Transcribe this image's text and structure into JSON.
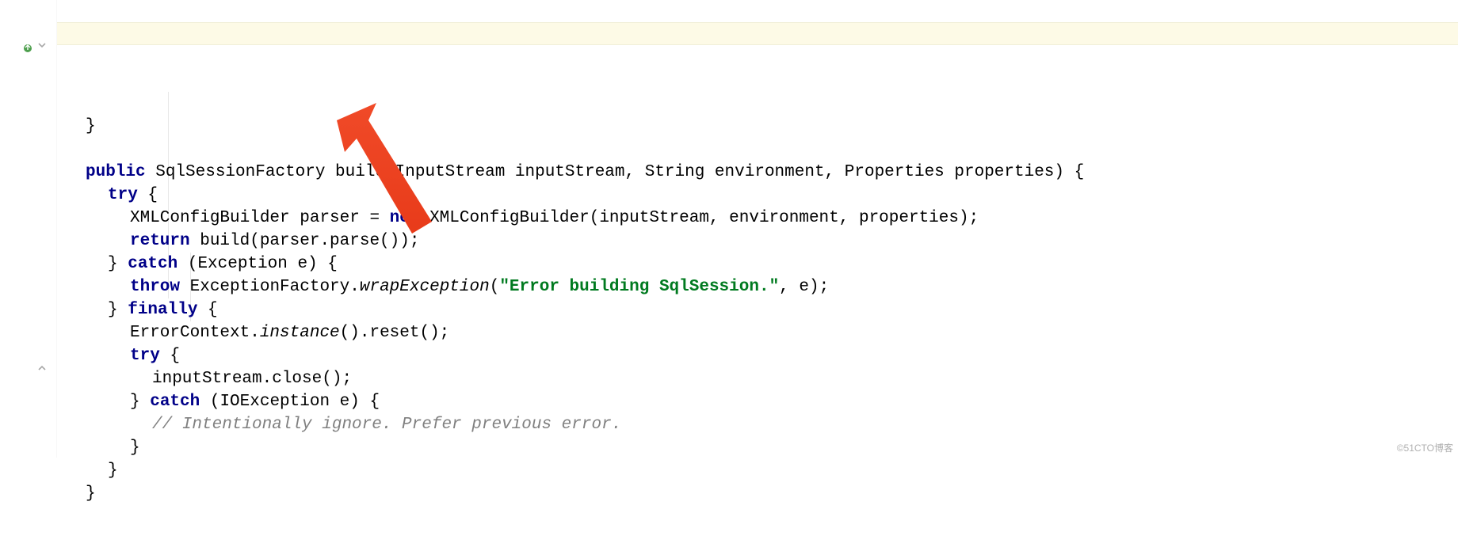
{
  "highlight_line_index": 1,
  "watermark": "©51CTO博客",
  "arrow_color": "#f04a28",
  "code": {
    "lines": [
      {
        "indent": 1,
        "tokens": [
          {
            "t": "}",
            "c": ""
          }
        ]
      },
      {
        "indent": 1,
        "tokens": []
      },
      {
        "indent": 1,
        "tokens": [
          {
            "t": "public ",
            "c": "kw"
          },
          {
            "t": "SqlSessionFactory build(InputStream inputStream, String environment, Properties properties) {",
            "c": ""
          }
        ]
      },
      {
        "indent": 2,
        "tokens": [
          {
            "t": "try ",
            "c": "kw"
          },
          {
            "t": "{",
            "c": ""
          }
        ]
      },
      {
        "indent": 3,
        "tokens": [
          {
            "t": "XMLConfigBuilder parser = ",
            "c": ""
          },
          {
            "t": "new ",
            "c": "kw"
          },
          {
            "t": "XMLConfigBuilder(inputStream, environment, properties);",
            "c": ""
          }
        ]
      },
      {
        "indent": 3,
        "tokens": [
          {
            "t": "return ",
            "c": "kw"
          },
          {
            "t": "build(parser.parse());",
            "c": ""
          }
        ]
      },
      {
        "indent": 2,
        "tokens": [
          {
            "t": "} ",
            "c": ""
          },
          {
            "t": "catch ",
            "c": "kw"
          },
          {
            "t": "(Exception e) {",
            "c": ""
          }
        ]
      },
      {
        "indent": 3,
        "tokens": [
          {
            "t": "throw ",
            "c": "kw"
          },
          {
            "t": "ExceptionFactory.",
            "c": ""
          },
          {
            "t": "wrapException",
            "c": "italic"
          },
          {
            "t": "(",
            "c": ""
          },
          {
            "t": "\"Error building SqlSession.\"",
            "c": "str"
          },
          {
            "t": ", e);",
            "c": ""
          }
        ]
      },
      {
        "indent": 2,
        "tokens": [
          {
            "t": "} ",
            "c": ""
          },
          {
            "t": "finally ",
            "c": "kw"
          },
          {
            "t": "{",
            "c": ""
          }
        ]
      },
      {
        "indent": 3,
        "tokens": [
          {
            "t": "ErrorContext.",
            "c": ""
          },
          {
            "t": "instance",
            "c": "italic"
          },
          {
            "t": "().reset();",
            "c": ""
          }
        ]
      },
      {
        "indent": 3,
        "tokens": [
          {
            "t": "try ",
            "c": "kw"
          },
          {
            "t": "{",
            "c": ""
          }
        ]
      },
      {
        "indent": 4,
        "tokens": [
          {
            "t": "inputStream.close();",
            "c": ""
          }
        ]
      },
      {
        "indent": 3,
        "tokens": [
          {
            "t": "} ",
            "c": ""
          },
          {
            "t": "catch ",
            "c": "kw"
          },
          {
            "t": "(IOException e) {",
            "c": ""
          }
        ]
      },
      {
        "indent": 4,
        "tokens": [
          {
            "t": "// Intentionally ignore. Prefer previous error.",
            "c": "comment"
          }
        ]
      },
      {
        "indent": 3,
        "tokens": [
          {
            "t": "}",
            "c": ""
          }
        ]
      },
      {
        "indent": 2,
        "tokens": [
          {
            "t": "}",
            "c": ""
          }
        ]
      },
      {
        "indent": 1,
        "tokens": [
          {
            "t": "}",
            "c": ""
          }
        ]
      }
    ]
  }
}
